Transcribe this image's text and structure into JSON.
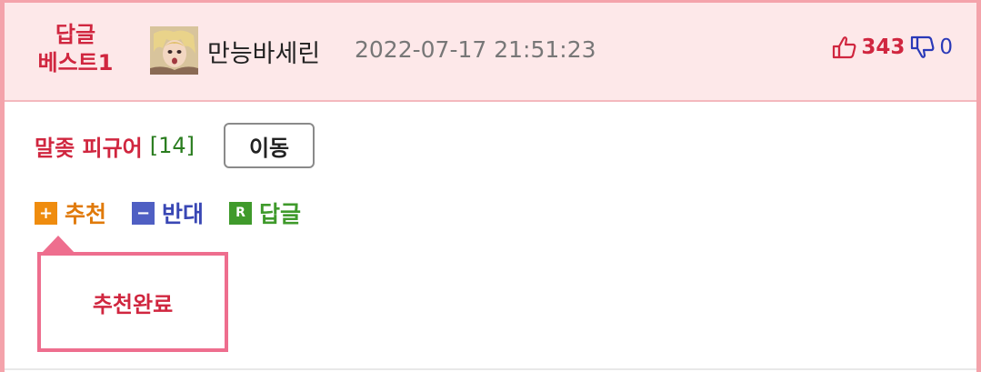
{
  "header": {
    "best_badge_line1": "답글",
    "best_badge_line2": "베스트1",
    "username": "만능바세린",
    "timestamp": "2022-07-17 21:51:23",
    "upvotes": "343",
    "downvotes": "0",
    "icons": {
      "up": "thumbs-up-icon",
      "down": "thumbs-down-icon",
      "avatar": "user-avatar"
    }
  },
  "post": {
    "title": "말좆 피규어",
    "comment_count": "[14]",
    "move_label": "이동"
  },
  "actions": {
    "recommend_icon": "+",
    "recommend_label": "추천",
    "oppose_icon": "−",
    "oppose_label": "반대",
    "reply_icon": "R",
    "reply_label": "답글"
  },
  "toast": {
    "message": "추천완료"
  },
  "colors": {
    "accent_red": "#d0263f",
    "border_pink": "#f4a3ab",
    "header_bg": "#fde8e9",
    "recommend_orange": "#ef8c0e",
    "oppose_blue": "#4f5fc3",
    "reply_green": "#3f9a2b",
    "toast_border": "#ee6e8e"
  }
}
